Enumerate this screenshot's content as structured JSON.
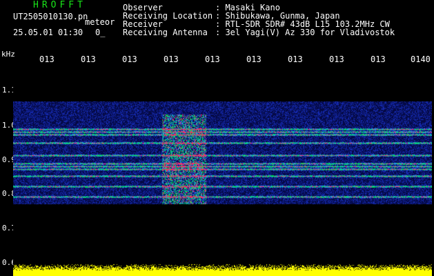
{
  "header": {
    "app_title": "HROFFT",
    "filename": "UT2505010130.pn",
    "label_meteor": "meteor",
    "datetime": "25.05.01 01:30",
    "counter": "0_",
    "meta": [
      {
        "key": "Observer",
        "value": ": Masaki Kano"
      },
      {
        "key": "Receiving Location",
        "value": ": Shibukawa, Gunma, Japan"
      },
      {
        "key": "Receiver",
        "value": ": RTL-SDR SDR# 43dB L15 103.2MHz CW"
      },
      {
        "key": "Receiving Antenna",
        "value": ": 3el Yagi(V) Az 330 for Vladivostok"
      }
    ]
  },
  "spectrogram": {
    "unit_label": "kHz",
    "y_labels": [
      "1.1",
      "1.0",
      "0.9",
      "0.8",
      "0.7",
      "0.6"
    ],
    "x_labels": [
      "013",
      "013",
      "013",
      "013",
      "013",
      "013",
      "013",
      "013",
      "013",
      "0140"
    ],
    "colors": {
      "background": "#000000",
      "noise": "#1a2aa0",
      "echo": "#00c060",
      "strong": "#ff2060",
      "baseline": "#ffff00",
      "title": "#19e619"
    }
  }
}
